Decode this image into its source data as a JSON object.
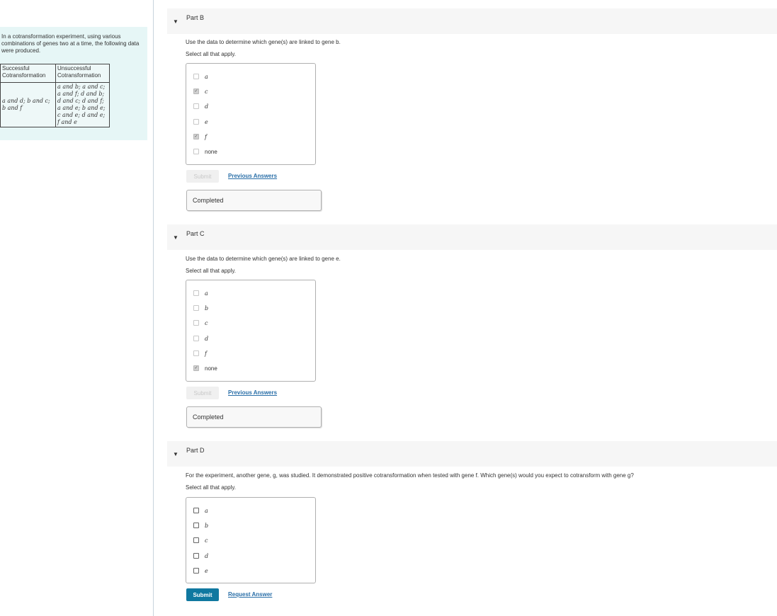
{
  "intro_text": "In a cotransformation experiment, using various combinations of genes two at a time, the following data were produced.",
  "table": {
    "header_successful": "Successful Cotransformation",
    "header_unsuccessful": "Unsuccessful Cotransformation",
    "successful_lines": [
      "a and d; b and c;",
      "b and f"
    ],
    "unsuccessful_lines": [
      "a and b; a and c;",
      "a and f; d and b;",
      "d and c; d and f;",
      "a and e; b and e;",
      "c and e; d and e;",
      "f and e"
    ]
  },
  "partB": {
    "title": "Part B",
    "question": "Use the data to determine which gene(s) are linked to gene b.",
    "instruction": "Select all that apply.",
    "options": [
      {
        "label": "a",
        "checked": false
      },
      {
        "label": "c",
        "checked": true
      },
      {
        "label": "d",
        "checked": false
      },
      {
        "label": "e",
        "checked": false
      },
      {
        "label": "f",
        "checked": true
      },
      {
        "label": "none",
        "checked": false
      }
    ],
    "submit": "Submit",
    "link": "Previous Answers",
    "status": "Completed"
  },
  "partC": {
    "title": "Part C",
    "question": "Use the data to determine which gene(s) are linked to gene e.",
    "instruction": "Select all that apply.",
    "options": [
      {
        "label": "a",
        "checked": false
      },
      {
        "label": "b",
        "checked": false
      },
      {
        "label": "c",
        "checked": false
      },
      {
        "label": "d",
        "checked": false
      },
      {
        "label": "f",
        "checked": false
      },
      {
        "label": "none",
        "checked": true
      }
    ],
    "submit": "Submit",
    "link": "Previous Answers",
    "status": "Completed"
  },
  "partD": {
    "title": "Part D",
    "question": "For the experiment, another gene, g, was studied. It demonstrated positive cotransformation when tested with gene f. Which gene(s) would you expect to cotransform with gene g?",
    "instruction": "Select all that apply.",
    "options": [
      {
        "label": "a",
        "checked": false
      },
      {
        "label": "b",
        "checked": false
      },
      {
        "label": "c",
        "checked": false
      },
      {
        "label": "d",
        "checked": false
      },
      {
        "label": "e",
        "checked": false
      }
    ],
    "submit": "Submit",
    "link": "Request Answer"
  }
}
